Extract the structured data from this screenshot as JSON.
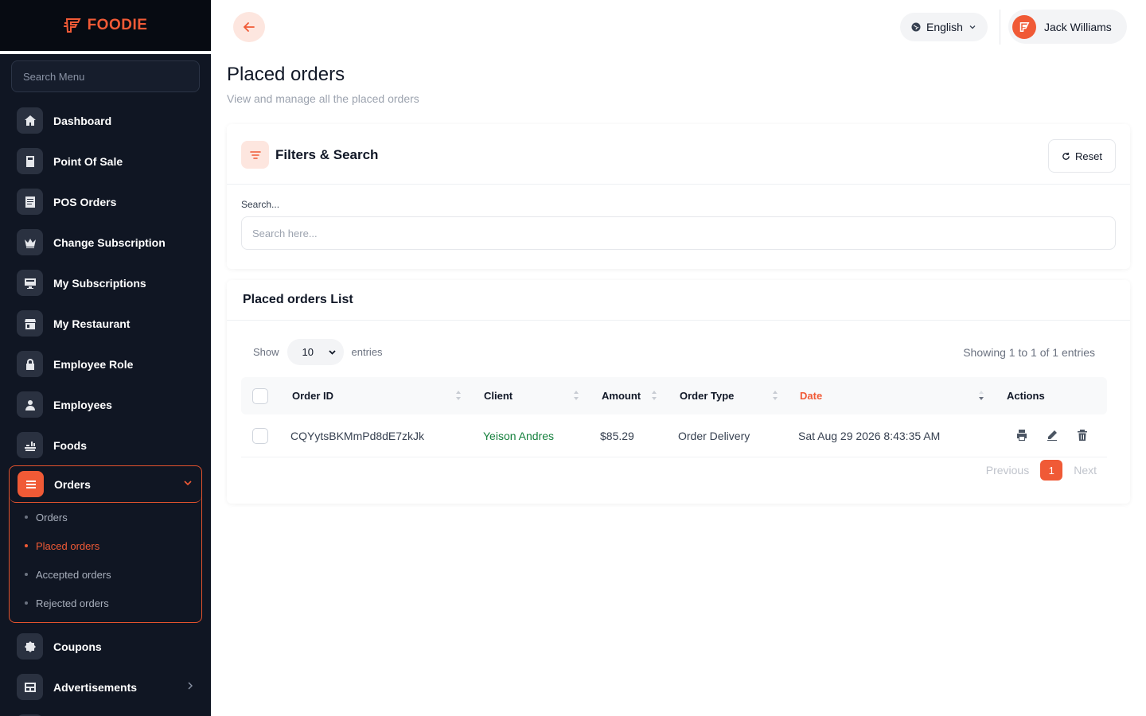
{
  "brand": {
    "name": "FOODIE",
    "accent": "#f05a36"
  },
  "sidebar": {
    "search_placeholder": "Search Menu",
    "items": [
      {
        "label": "Dashboard",
        "icon": "home-icon"
      },
      {
        "label": "Point Of Sale",
        "icon": "calculator-icon"
      },
      {
        "label": "POS Orders",
        "icon": "receipt-icon"
      },
      {
        "label": "Change Subscription",
        "icon": "crown-icon"
      },
      {
        "label": "My Subscriptions",
        "icon": "monitor-icon"
      },
      {
        "label": "My Restaurant",
        "icon": "store-icon"
      },
      {
        "label": "Employee Role",
        "icon": "lock-icon"
      },
      {
        "label": "Employees",
        "icon": "user-icon"
      },
      {
        "label": "Foods",
        "icon": "food-icon"
      }
    ],
    "orders": {
      "label": "Orders",
      "sub_items": [
        {
          "label": "Orders",
          "active": false
        },
        {
          "label": "Placed orders",
          "active": true
        },
        {
          "label": "Accepted orders",
          "active": false
        },
        {
          "label": "Rejected orders",
          "active": false
        }
      ]
    },
    "bottom_items": [
      {
        "label": "Coupons",
        "icon": "badge-percent-icon"
      },
      {
        "label": "Advertisements",
        "icon": "ad-icon"
      }
    ]
  },
  "topbar": {
    "language": "English",
    "user_name": "Jack Williams"
  },
  "page": {
    "title": "Placed orders",
    "subtitle": "View and manage all the placed orders"
  },
  "filters": {
    "title": "Filters & Search",
    "reset_label": "Reset",
    "search_label": "Search...",
    "search_placeholder": "Search here..."
  },
  "list": {
    "title": "Placed orders List",
    "show_label": "Show",
    "entries_value": "10",
    "entries_label": "entries",
    "showing_text": "Showing 1 to 1 of 1 entries",
    "columns": {
      "order_id": "Order ID",
      "client": "Client",
      "amount": "Amount",
      "order_type": "Order Type",
      "date": "Date",
      "actions": "Actions"
    },
    "rows": [
      {
        "order_id": "CQYytsBKMmPd8dE7zkJk",
        "client": "Yeison Andres",
        "amount": "$85.29",
        "order_type": "Order Delivery",
        "date": "Sat Aug 29 2026 8:43:35 AM"
      }
    ],
    "pagination": {
      "previous": "Previous",
      "current": "1",
      "next": "Next"
    }
  }
}
